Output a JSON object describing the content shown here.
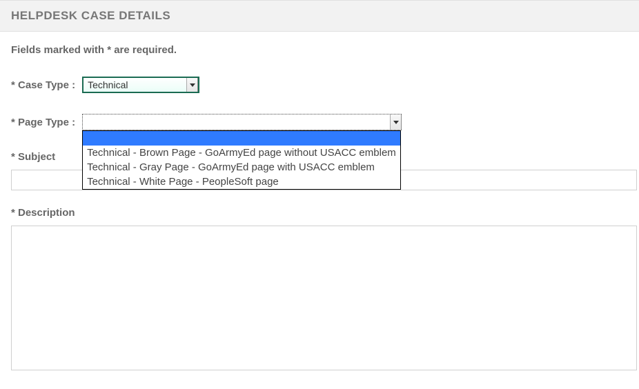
{
  "header": {
    "title": "HELPDESK CASE DETAILS"
  },
  "note": "Fields marked with * are required.",
  "fields": {
    "case_type": {
      "label": "* Case Type :",
      "value": "Technical"
    },
    "page_type": {
      "label": "* Page Type :",
      "value": "",
      "options": [
        "",
        "Technical - Brown Page - GoArmyEd page without USACC emblem",
        "Technical - Gray Page - GoArmyEd page with USACC emblem",
        "Technical - White Page - PeopleSoft page"
      ]
    },
    "subject": {
      "label": "* Subject",
      "value": ""
    },
    "description": {
      "label": "* Description",
      "value": ""
    }
  }
}
